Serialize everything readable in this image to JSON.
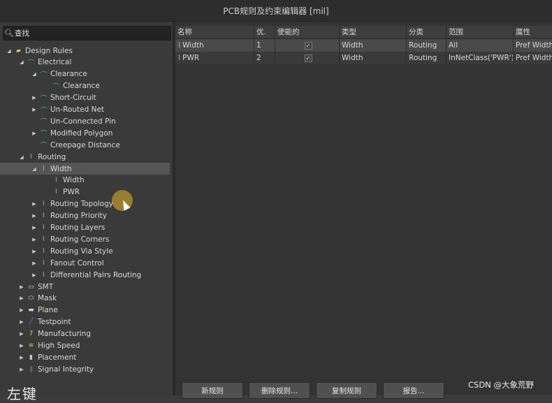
{
  "window": {
    "title": "PCB规则及约束编辑器 [mil]"
  },
  "search": {
    "value": "查找",
    "icon": "search-icon"
  },
  "tree": [
    {
      "label": "Design Rules",
      "indent": 0,
      "expand": "open",
      "icon": "folder-icon",
      "color": "#e8c84a"
    },
    {
      "label": "Electrical",
      "indent": 1,
      "expand": "open",
      "icon": "electrical-rule-icon",
      "color": "#3fbf9f"
    },
    {
      "label": "Clearance",
      "indent": 2,
      "expand": "open",
      "icon": "electrical-rule-icon",
      "color": "#3fbf9f"
    },
    {
      "label": "Clearance",
      "indent": 3,
      "expand": "none",
      "icon": "electrical-rule-icon",
      "color": "#3fbf9f"
    },
    {
      "label": "Short-Circuit",
      "indent": 2,
      "expand": "closed",
      "icon": "electrical-rule-icon",
      "color": "#3fbf9f"
    },
    {
      "label": "Un-Routed Net",
      "indent": 2,
      "expand": "closed",
      "icon": "electrical-rule-icon",
      "color": "#3fbf9f"
    },
    {
      "label": "Un-Connected Pin",
      "indent": 2,
      "expand": "none",
      "icon": "electrical-rule-icon",
      "color": "#3fbf9f"
    },
    {
      "label": "Modified Polygon",
      "indent": 2,
      "expand": "closed",
      "icon": "electrical-rule-icon",
      "color": "#3fbf9f"
    },
    {
      "label": "Creepage Distance",
      "indent": 2,
      "expand": "none",
      "icon": "electrical-rule-icon",
      "color": "#3fbf9f"
    },
    {
      "label": "Routing",
      "indent": 1,
      "expand": "open",
      "icon": "routing-rule-icon",
      "color": "#b8b8b8"
    },
    {
      "label": "Width",
      "indent": 2,
      "expand": "open",
      "icon": "routing-rule-icon",
      "color": "#b8b8b8",
      "selected": true
    },
    {
      "label": "Width",
      "indent": 3,
      "expand": "none",
      "icon": "routing-rule-icon",
      "color": "#b8b8b8"
    },
    {
      "label": "PWR",
      "indent": 3,
      "expand": "none",
      "icon": "routing-rule-icon",
      "color": "#b8b8b8"
    },
    {
      "label": "Routing Topology",
      "indent": 2,
      "expand": "closed",
      "icon": "routing-rule-icon",
      "color": "#b8b8b8"
    },
    {
      "label": "Routing Priority",
      "indent": 2,
      "expand": "closed",
      "icon": "routing-rule-icon",
      "color": "#b8b8b8"
    },
    {
      "label": "Routing Layers",
      "indent": 2,
      "expand": "closed",
      "icon": "routing-rule-icon",
      "color": "#b8b8b8"
    },
    {
      "label": "Routing Corners",
      "indent": 2,
      "expand": "closed",
      "icon": "routing-rule-icon",
      "color": "#b8b8b8"
    },
    {
      "label": "Routing Via Style",
      "indent": 2,
      "expand": "closed",
      "icon": "routing-rule-icon",
      "color": "#b8b8b8"
    },
    {
      "label": "Fanout Control",
      "indent": 2,
      "expand": "closed",
      "icon": "routing-rule-icon",
      "color": "#b8b8b8"
    },
    {
      "label": "Differential Pairs Routing",
      "indent": 2,
      "expand": "closed",
      "icon": "routing-rule-icon",
      "color": "#b8b8b8"
    },
    {
      "label": "SMT",
      "indent": 1,
      "expand": "closed",
      "icon": "smt-icon",
      "color": "#d0d0d0"
    },
    {
      "label": "Mask",
      "indent": 1,
      "expand": "closed",
      "icon": "mask-icon",
      "color": "#d0d0d0"
    },
    {
      "label": "Plane",
      "indent": 1,
      "expand": "closed",
      "icon": "plane-icon",
      "color": "#d0d0d0"
    },
    {
      "label": "Testpoint",
      "indent": 1,
      "expand": "closed",
      "icon": "testpoint-icon",
      "color": "#4a8ad8"
    },
    {
      "label": "Manufacturing",
      "indent": 1,
      "expand": "closed",
      "icon": "manufacturing-icon",
      "color": "#e8c84a"
    },
    {
      "label": "High Speed",
      "indent": 1,
      "expand": "closed",
      "icon": "high-speed-icon",
      "color": "#e8c84a"
    },
    {
      "label": "Placement",
      "indent": 1,
      "expand": "closed",
      "icon": "placement-icon",
      "color": "#c8c8c8"
    },
    {
      "label": "Signal Integrity",
      "indent": 1,
      "expand": "closed",
      "icon": "signal-integrity-icon",
      "color": "#888888"
    }
  ],
  "table": {
    "columns": [
      "名称",
      "优.",
      "使能的",
      "类型",
      "分类",
      "范围",
      "属性"
    ],
    "rows": [
      {
        "name": "Width",
        "priority": "1",
        "enabled": true,
        "type": "Width",
        "category": "Routing",
        "scope": "All",
        "attr": "Pref Width"
      },
      {
        "name": "PWR",
        "priority": "2",
        "enabled": true,
        "type": "Width",
        "category": "Routing",
        "scope": "InNetClass('PWR')",
        "attr": "Pref Width"
      }
    ]
  },
  "buttons": {
    "new_rule": "新规则",
    "delete_rule": "删除规则...",
    "copy_rule": "复制规则",
    "report": "报告..."
  },
  "overlay": {
    "watermark": "CSDN @大象荒野",
    "corner_text": "左键"
  }
}
